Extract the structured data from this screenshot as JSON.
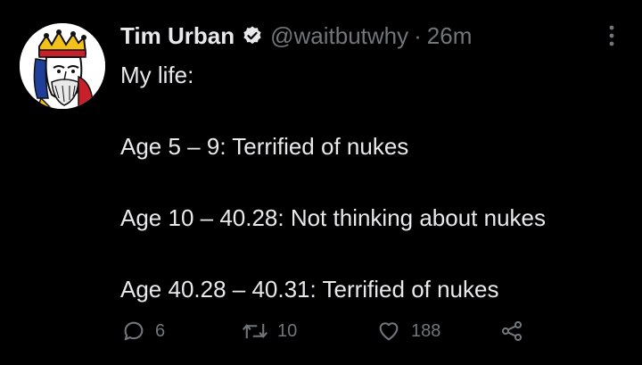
{
  "author": {
    "name": "Tim Urban",
    "handle": "@waitbutwhy",
    "separator": "·",
    "timestamp": "26m"
  },
  "tweet": {
    "lines": [
      "My life:",
      "",
      "Age 5 – 9: Terrified of nukes",
      "",
      "Age 10 – 40.28: Not thinking about nukes",
      "",
      "Age 40.28 – 40.31: Terrified of nukes"
    ]
  },
  "actions": {
    "reply": {
      "icon": "reply-icon",
      "count": "6"
    },
    "retweet": {
      "icon": "retweet-icon",
      "count": "10"
    },
    "like": {
      "icon": "heart-icon",
      "count": "188"
    },
    "share": {
      "icon": "share-icon"
    }
  },
  "colors": {
    "background": "#000000",
    "text": "#e7e9ea",
    "secondary": "#71767b"
  }
}
